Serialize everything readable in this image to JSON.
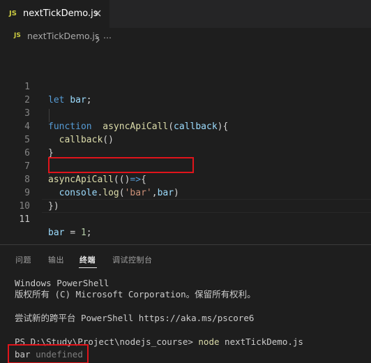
{
  "tab": {
    "badge": "JS",
    "title": "nextTickDemo.js"
  },
  "breadcrumb": {
    "badge": "JS",
    "file": "nextTickDemo.js",
    "ellipsis": "..."
  },
  "editor": {
    "line_numbers": [
      "1",
      "2",
      "3",
      "4",
      "5",
      "6",
      "7",
      "8",
      "9",
      "10",
      "11"
    ],
    "active_line": "11"
  },
  "panel": {
    "tabs": [
      "问题",
      "输出",
      "终端",
      "调试控制台"
    ],
    "active_tab": "终端"
  },
  "terminal": {
    "line1": "Windows PowerShell",
    "line2": "版权所有 (C) Microsoft Corporation。保留所有权利。",
    "line3": "尝试新的跨平台 PowerShell https://aka.ms/pscore6",
    "prompt": "PS D:\\Study\\Project\\nodejs_course>",
    "command": "node",
    "arg": "nextTickDemo.js",
    "out_bar": "bar",
    "out_value": "undefined"
  },
  "colors": {
    "highlight_box": "#e0141b",
    "keyword": "#569cd6",
    "variable": "#9cdcfe",
    "function": "#dcdcaa",
    "string": "#ce9178",
    "number": "#b5cea8"
  }
}
